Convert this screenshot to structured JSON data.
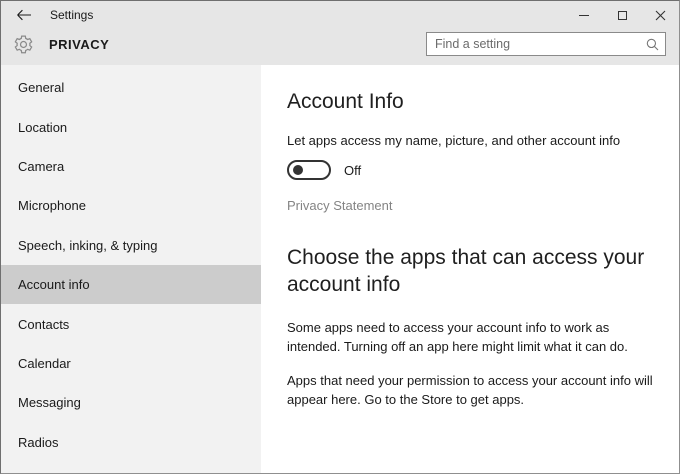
{
  "titlebar": {
    "title": "Settings"
  },
  "header": {
    "page_title": "PRIVACY",
    "search_placeholder": "Find a setting"
  },
  "sidebar": {
    "items": [
      "General",
      "Location",
      "Camera",
      "Microphone",
      "Speech, inking, & typing",
      "Account info",
      "Contacts",
      "Calendar",
      "Messaging",
      "Radios"
    ],
    "selected": "Account info"
  },
  "main": {
    "title": "Account Info",
    "toggle_label": "Let apps access my name, picture, and other account info",
    "toggle_state": "Off",
    "privacy_link": "Privacy Statement",
    "section_title": "Choose the apps that can access your account info",
    "paragraph1": "Some apps need to access your account info to work as intended. Turning off an app here might limit what it can do.",
    "paragraph2": "Apps that need your permission to access your account info will appear here. Go to the Store to get apps."
  },
  "colors": {
    "chrome_bg": "#e6e6e6",
    "sidebar_bg": "#f2f2f2",
    "selected_item_bg": "#cccccc",
    "content_bg": "#ffffff",
    "muted_text": "#848484",
    "toggle_outline": "#333333"
  }
}
